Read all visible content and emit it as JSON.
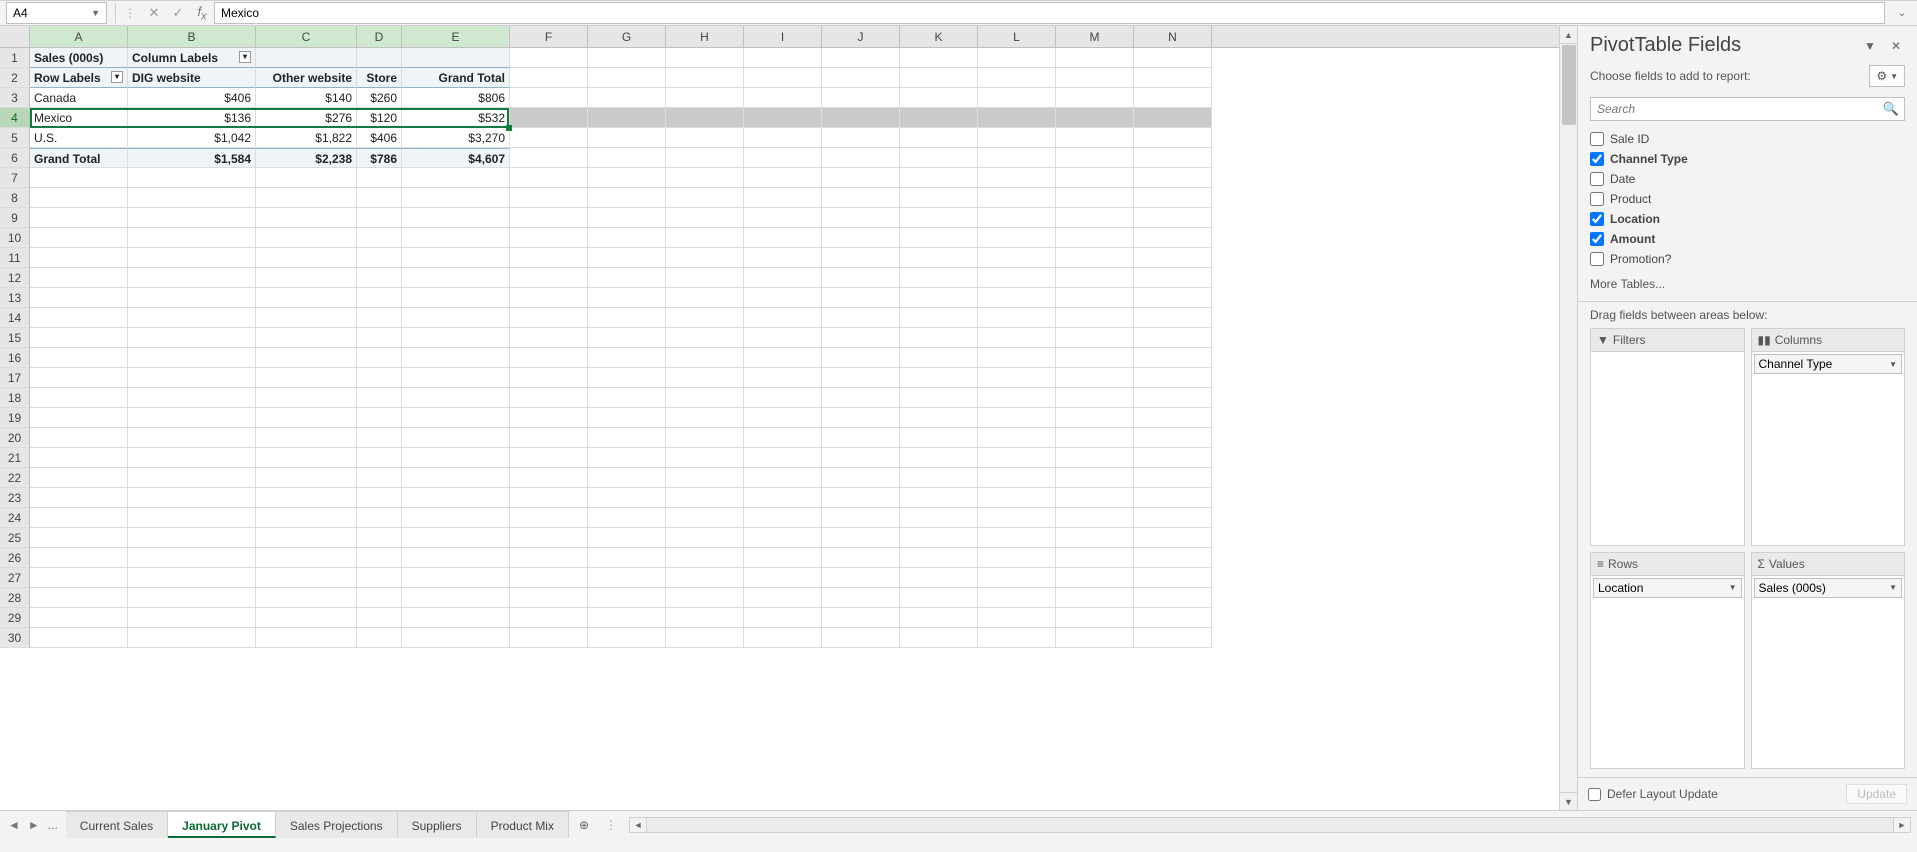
{
  "name_box": "A4",
  "formula_value": "Mexico",
  "col_headers": [
    "A",
    "B",
    "C",
    "D",
    "E",
    "F",
    "G",
    "H",
    "I",
    "J",
    "K",
    "L",
    "M",
    "N"
  ],
  "row_count": 30,
  "selected_row": 4,
  "pivot": {
    "r1": {
      "A": "Sales (000s)",
      "B": "Column Labels"
    },
    "r2": {
      "A": "Row Labels",
      "B": "DIG website",
      "C": "Other website",
      "D": "Store",
      "E": "Grand Total"
    },
    "r3": {
      "A": "Canada",
      "B": "$406",
      "C": "$140",
      "D": "$260",
      "E": "$806"
    },
    "r4": {
      "A": "Mexico",
      "B": "$136",
      "C": "$276",
      "D": "$120",
      "E": "$532"
    },
    "r5": {
      "A": "U.S.",
      "B": "$1,042",
      "C": "$1,822",
      "D": "$406",
      "E": "$3,270"
    },
    "r6": {
      "A": "Grand Total",
      "B": "$1,584",
      "C": "$2,238",
      "D": "$786",
      "E": "$4,607"
    }
  },
  "panel": {
    "title": "PivotTable Fields",
    "subtitle": "Choose fields to add to report:",
    "search_placeholder": "Search",
    "fields": [
      {
        "label": "Sale ID",
        "checked": false
      },
      {
        "label": "Channel Type",
        "checked": true
      },
      {
        "label": "Date",
        "checked": false
      },
      {
        "label": "Product",
        "checked": false
      },
      {
        "label": "Location",
        "checked": true
      },
      {
        "label": "Amount",
        "checked": true
      },
      {
        "label": "Promotion?",
        "checked": false
      }
    ],
    "more_tables": "More Tables...",
    "drag_label": "Drag fields between areas below:",
    "areas": {
      "filters": {
        "title": "Filters",
        "items": []
      },
      "columns": {
        "title": "Columns",
        "items": [
          "Channel Type"
        ]
      },
      "rows": {
        "title": "Rows",
        "items": [
          "Location"
        ]
      },
      "values": {
        "title": "Values",
        "items": [
          "Sales (000s)"
        ]
      }
    },
    "defer_label": "Defer Layout Update",
    "update_label": "Update"
  },
  "tabs": {
    "items": [
      "Current Sales",
      "January Pivot",
      "Sales Projections",
      "Suppliers",
      "Product Mix"
    ],
    "active": 1,
    "ellipsis": "..."
  },
  "chart_data": {
    "type": "table",
    "title": "Sales (000s)",
    "col_dimension": "Channel Type",
    "row_dimension": "Location",
    "columns": [
      "DIG website",
      "Other website",
      "Store",
      "Grand Total"
    ],
    "rows": [
      "Canada",
      "Mexico",
      "U.S.",
      "Grand Total"
    ],
    "values": [
      [
        406,
        140,
        260,
        806
      ],
      [
        136,
        276,
        120,
        532
      ],
      [
        1042,
        1822,
        406,
        3270
      ],
      [
        1584,
        2238,
        786,
        4607
      ]
    ],
    "unit": "$ (000s)"
  }
}
